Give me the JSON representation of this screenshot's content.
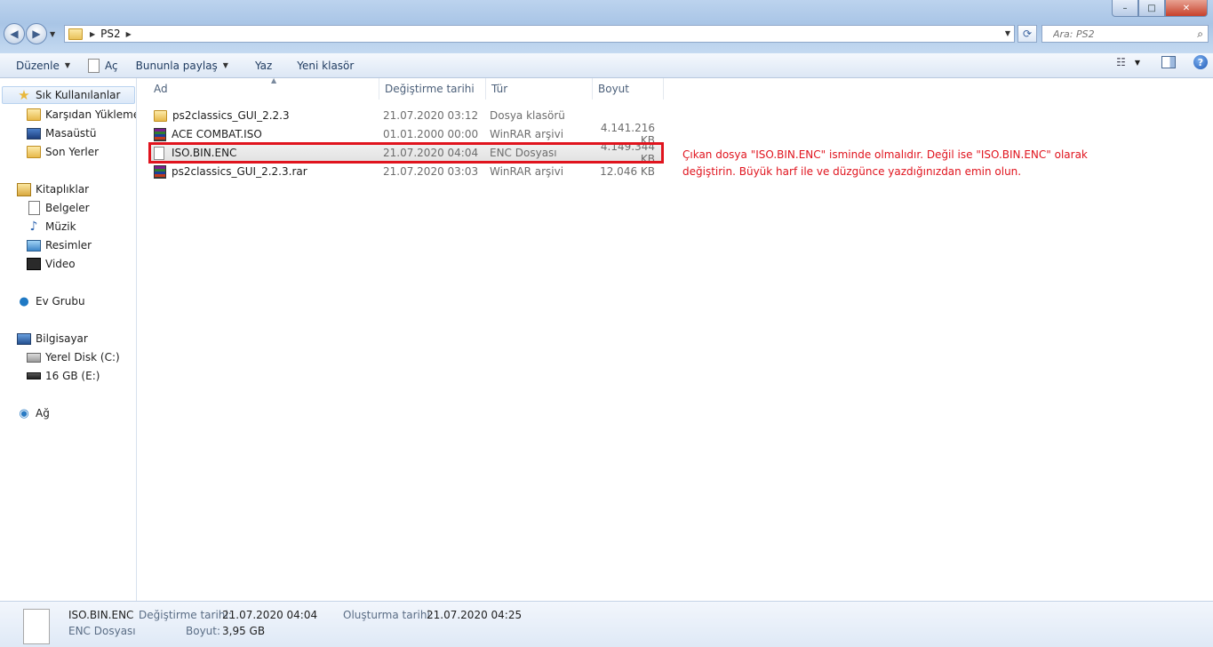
{
  "window": {
    "breadcrumb": [
      "PS2"
    ],
    "search_placeholder": "Ara: PS2",
    "controls": {
      "min": "–",
      "max": "□",
      "close": "✕"
    }
  },
  "toolbar": {
    "organize": "Düzenle",
    "open": "Aç",
    "share": "Bununla paylaş",
    "print": "Yaz",
    "new_folder": "Yeni klasör"
  },
  "nav": {
    "favorites": "Sık Kullanılanlar",
    "downloads": "Karşıdan Yüklemeler",
    "desktop": "Masaüstü",
    "recent": "Son Yerler",
    "libraries": "Kitaplıklar",
    "documents": "Belgeler",
    "music": "Müzik",
    "pictures": "Resimler",
    "video": "Video",
    "homegroup": "Ev Grubu",
    "computer": "Bilgisayar",
    "local_disk": "Yerel Disk (C:)",
    "usb": "16 GB (E:)",
    "network": "Ağ"
  },
  "columns": {
    "name": "Ad",
    "date": "Değiştirme tarihi",
    "type": "Tür",
    "size": "Boyut"
  },
  "files": [
    {
      "name": "ps2classics_GUI_2.2.3",
      "date": "21.07.2020 03:12",
      "type": "Dosya klasörü",
      "size": "",
      "icon": "folder-icon"
    },
    {
      "name": "ACE COMBAT.ISO",
      "date": "01.01.2000 00:00",
      "type": "WinRAR arşivi",
      "size": "4.141.216 KB",
      "icon": "rar-icon"
    },
    {
      "name": "ISO.BIN.ENC",
      "date": "21.07.2020 04:04",
      "type": "ENC Dosyası",
      "size": "4.149.344 KB",
      "icon": "file-icon"
    },
    {
      "name": "ps2classics_GUI_2.2.3.rar",
      "date": "21.07.2020 03:03",
      "type": "WinRAR arşivi",
      "size": "12.046 KB",
      "icon": "rar-icon"
    }
  ],
  "annotation": {
    "line1": "Çıkan dosya \"ISO.BIN.ENC\" isminde olmalıdır. Değil ise \"ISO.BIN.ENC\" olarak",
    "line2": "değiştirin. Büyük harf ile ve düzgünce yazdığınızdan emin olun."
  },
  "details": {
    "name": "ISO.BIN.ENC",
    "type": "ENC Dosyası",
    "modified_label": "Değiştirme tarihi:",
    "modified_value": "21.07.2020 04:04",
    "size_label": "Boyut:",
    "size_value": "3,95 GB",
    "created_label": "Oluşturma tarihi:",
    "created_value": "21.07.2020 04:25"
  },
  "colors": {
    "highlight": "#e0141e",
    "accent": "#1e3a5f"
  }
}
